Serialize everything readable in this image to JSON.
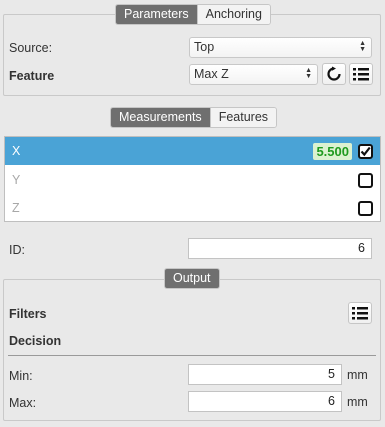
{
  "params_tabs": [
    "Parameters",
    "Anchoring"
  ],
  "source": {
    "label": "Source:",
    "value": "Top"
  },
  "feature": {
    "label": "Feature",
    "value": "Max Z"
  },
  "meas_tabs": [
    "Measurements",
    "Features"
  ],
  "measurements": [
    {
      "label": "X",
      "value": "5.500",
      "checked": true,
      "selected": true
    },
    {
      "label": "Y",
      "checked": false
    },
    {
      "label": "Z",
      "checked": false
    }
  ],
  "id_field": {
    "label": "ID:",
    "value": "6"
  },
  "output_tab": "Output",
  "filters_label": "Filters",
  "decision_label": "Decision",
  "min": {
    "label": "Min:",
    "value": "5",
    "unit": "mm"
  },
  "max": {
    "label": "Max:",
    "value": "6",
    "unit": "mm"
  },
  "colors": {
    "selection": "#4aa3d6",
    "active_tab": "#6f6f6f",
    "value_green": "#1f9a1f"
  }
}
